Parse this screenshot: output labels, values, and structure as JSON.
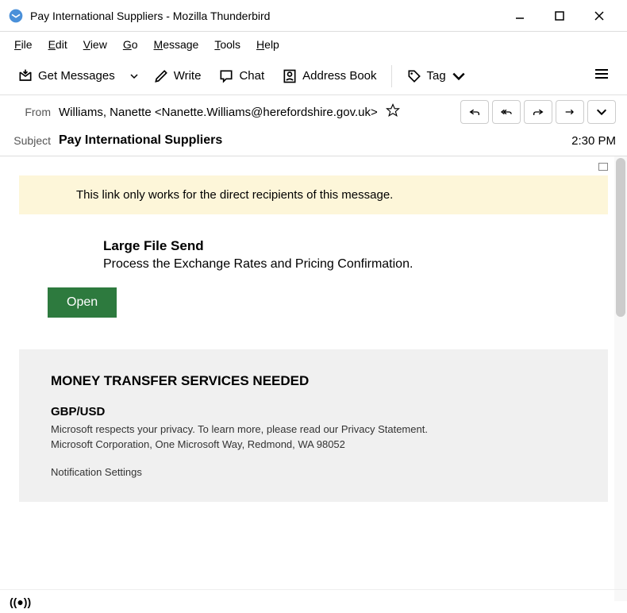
{
  "window": {
    "title": "Pay International Suppliers - Mozilla Thunderbird"
  },
  "menu": {
    "file": "File",
    "edit": "Edit",
    "view": "View",
    "go": "Go",
    "message": "Message",
    "tools": "Tools",
    "help": "Help"
  },
  "toolbar": {
    "get_messages": "Get Messages",
    "write": "Write",
    "chat": "Chat",
    "address_book": "Address Book",
    "tag": "Tag"
  },
  "header": {
    "from_label": "From",
    "from_value": "Williams, Nanette <Nanette.Williams@herefordshire.gov.uk>",
    "subject_label": "Subject",
    "subject_value": "Pay International Suppliers",
    "time": "2:30 PM"
  },
  "message": {
    "notice": "This link only works for the direct recipients of this message.",
    "file_title": "Large File Send",
    "file_desc": "Process the Exchange Rates and Pricing Confirmation.",
    "open_button": "Open",
    "footer_title": "MONEY TRANSFER SERVICES NEEDED",
    "footer_currency": "GBP/USD",
    "footer_privacy": "Microsoft respects your privacy. To learn more, please read our Privacy Statement.",
    "footer_address": "Microsoft Corporation, One Microsoft Way, Redmond, WA 98052",
    "footer_settings": "Notification Settings"
  }
}
